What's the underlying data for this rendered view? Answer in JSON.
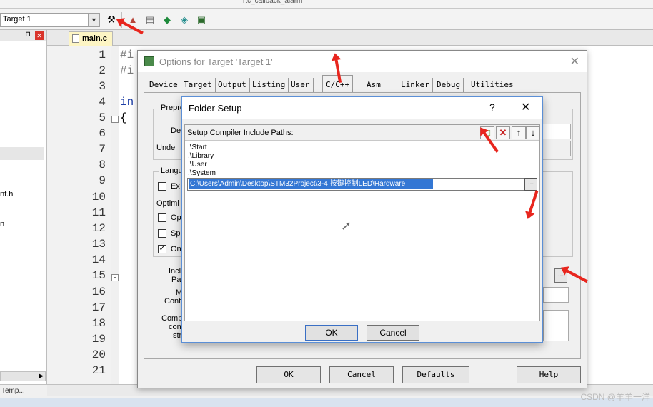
{
  "top_toolbar": {
    "file_hint": "rtc_callback_alarm"
  },
  "target_select": {
    "value": "Target 1"
  },
  "left_panel": {
    "item1": "nf.h",
    "item2": "n",
    "bottom_tab": "Temp..."
  },
  "editor": {
    "tab_label": "main.c",
    "line_numbers": [
      "1",
      "2",
      "3",
      "4",
      "5",
      "6",
      "7",
      "8",
      "9",
      "10",
      "11",
      "12",
      "13",
      "14",
      "15",
      "16",
      "17",
      "18",
      "19",
      "20",
      "21"
    ],
    "code_fragments": {
      "l1": "#i",
      "l2": "#i",
      "l4": "in",
      "l5": "{"
    }
  },
  "options_dialog": {
    "title": "Options for Target 'Target 1'",
    "tabs": [
      "Device",
      "Target",
      "Output",
      "Listing",
      "User",
      "C/C++",
      "Asm",
      "Linker",
      "Debug",
      "Utilities"
    ],
    "active_tab": "C/C++",
    "groups": {
      "preprocessor": "Prepro",
      "language": "Langu",
      "optimize": "Optimi"
    },
    "labels": {
      "define": "De",
      "undefine": "Unde",
      "ex": "Ex",
      "op": "Op",
      "sp": "Sp",
      "on": "On",
      "include": "Inclu",
      "paths": "Pa",
      "misc": "M",
      "controls": "Contr",
      "compiler": "Comp",
      "con": "con",
      "str": "str"
    },
    "buttons": {
      "ok": "OK",
      "cancel": "Cancel",
      "defaults": "Defaults",
      "help": "Help"
    }
  },
  "folder_setup": {
    "title": "Folder Setup",
    "help": "?",
    "close": "✕",
    "header_label": "Setup Compiler Include Paths:",
    "paths": [
      ".\\Start",
      ".\\Library",
      ".\\User",
      ".\\System"
    ],
    "editing_path": "C:\\Users\\Admin\\Desktop\\STM32Project\\3-4 按键控制LED\\Hardware",
    "browse_label": "...",
    "ok": "OK",
    "cancel": "Cancel"
  },
  "watermark": "CSDN @羊羊一洋",
  "accent_colors": {
    "annotation_arrow": "#e8261e",
    "selection": "#3477d4"
  }
}
